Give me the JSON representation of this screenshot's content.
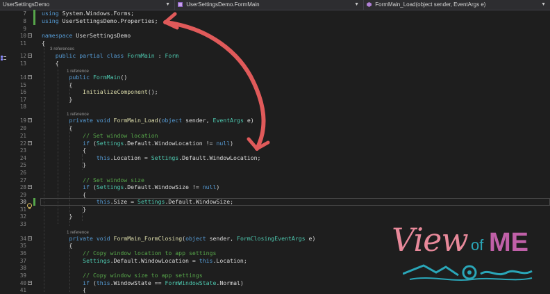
{
  "navigation_bar": {
    "project_dropdown": "UserSettingsDemo",
    "class_dropdown": "UserSettingsDemo.FormMain",
    "member_dropdown": "FormMain_Load(object sender, EventArgs e)"
  },
  "codelens": {
    "refs_3": "3 references",
    "refs_1": "1 reference"
  },
  "lines": [
    {
      "num": "7",
      "code": [
        [
          "k",
          "using"
        ],
        [
          "p",
          " System.Windows.Forms;"
        ]
      ]
    },
    {
      "num": "8",
      "code": [
        [
          "k",
          "using"
        ],
        [
          "p",
          " UserSettingsDemo.Properties;"
        ]
      ]
    },
    {
      "num": "9",
      "code": []
    },
    {
      "num": "10",
      "code": [
        [
          "k",
          "namespace"
        ],
        [
          "p",
          " UserSettingsDemo"
        ]
      ]
    },
    {
      "num": "11",
      "code": [
        [
          "p",
          "{"
        ]
      ]
    },
    {
      "num": "12",
      "code": [
        [
          "p",
          "    "
        ],
        [
          "k",
          "public partial class"
        ],
        [
          "p",
          " "
        ],
        [
          "t",
          "FormMain"
        ],
        [
          "p",
          " : "
        ],
        [
          "t",
          "Form"
        ]
      ]
    },
    {
      "num": "13",
      "code": [
        [
          "p",
          "    {"
        ]
      ]
    },
    {
      "num": "14",
      "code": [
        [
          "p",
          "        "
        ],
        [
          "k",
          "public"
        ],
        [
          "p",
          " "
        ],
        [
          "t",
          "FormMain"
        ],
        [
          "p",
          "()"
        ]
      ]
    },
    {
      "num": "15",
      "code": [
        [
          "p",
          "        {"
        ]
      ]
    },
    {
      "num": "16",
      "code": [
        [
          "p",
          "            "
        ],
        [
          "m",
          "InitializeComponent"
        ],
        [
          "p",
          "();"
        ]
      ]
    },
    {
      "num": "17",
      "code": [
        [
          "p",
          "        }"
        ]
      ]
    },
    {
      "num": "18",
      "code": []
    },
    {
      "num": "19",
      "code": [
        [
          "p",
          "        "
        ],
        [
          "k",
          "private void"
        ],
        [
          "p",
          " "
        ],
        [
          "m",
          "FormMain_Load"
        ],
        [
          "p",
          "("
        ],
        [
          "k",
          "object"
        ],
        [
          "p",
          " sender, "
        ],
        [
          "t",
          "EventArgs"
        ],
        [
          "p",
          " e)"
        ]
      ]
    },
    {
      "num": "20",
      "code": [
        [
          "p",
          "        {"
        ]
      ]
    },
    {
      "num": "21",
      "code": [
        [
          "p",
          "            "
        ],
        [
          "c",
          "// Set window location"
        ]
      ]
    },
    {
      "num": "22",
      "code": [
        [
          "p",
          "            "
        ],
        [
          "k",
          "if"
        ],
        [
          "p",
          " ("
        ],
        [
          "t",
          "Settings"
        ],
        [
          "p",
          ".Default.WindowLocation != "
        ],
        [
          "k",
          "null"
        ],
        [
          "p",
          ")"
        ]
      ]
    },
    {
      "num": "23",
      "code": [
        [
          "p",
          "            {"
        ]
      ]
    },
    {
      "num": "24",
      "code": [
        [
          "p",
          "                "
        ],
        [
          "k",
          "this"
        ],
        [
          "p",
          ".Location = "
        ],
        [
          "t",
          "Settings"
        ],
        [
          "p",
          ".Default.WindowLocation;"
        ]
      ]
    },
    {
      "num": "25",
      "code": [
        [
          "p",
          "            }"
        ]
      ]
    },
    {
      "num": "26",
      "code": []
    },
    {
      "num": "27",
      "code": [
        [
          "p",
          "            "
        ],
        [
          "c",
          "// Set window size"
        ]
      ]
    },
    {
      "num": "28",
      "code": [
        [
          "p",
          "            "
        ],
        [
          "k",
          "if"
        ],
        [
          "p",
          " ("
        ],
        [
          "t",
          "Settings"
        ],
        [
          "p",
          ".Default.WindowSize != "
        ],
        [
          "k",
          "null"
        ],
        [
          "p",
          ")"
        ]
      ]
    },
    {
      "num": "29",
      "code": [
        [
          "p",
          "            {"
        ]
      ]
    },
    {
      "num": "30",
      "code": [
        [
          "p",
          "                "
        ],
        [
          "k",
          "this"
        ],
        [
          "p",
          ".Size = "
        ],
        [
          "t",
          "Settings"
        ],
        [
          "p",
          ".Default.WindowSize;"
        ]
      ]
    },
    {
      "num": "31",
      "code": [
        [
          "p",
          "            }"
        ]
      ]
    },
    {
      "num": "32",
      "code": [
        [
          "p",
          "        }"
        ]
      ]
    },
    {
      "num": "33",
      "code": []
    },
    {
      "num": "34",
      "code": [
        [
          "p",
          "        "
        ],
        [
          "k",
          "private void"
        ],
        [
          "p",
          " "
        ],
        [
          "m",
          "FormMain_FormClosing"
        ],
        [
          "p",
          "("
        ],
        [
          "k",
          "object"
        ],
        [
          "p",
          " sender, "
        ],
        [
          "t",
          "FormClosingEventArgs"
        ],
        [
          "p",
          " e)"
        ]
      ]
    },
    {
      "num": "35",
      "code": [
        [
          "p",
          "        {"
        ]
      ]
    },
    {
      "num": "36",
      "code": [
        [
          "p",
          "            "
        ],
        [
          "c",
          "// Copy window location to app settings"
        ]
      ]
    },
    {
      "num": "37",
      "code": [
        [
          "p",
          "            "
        ],
        [
          "t",
          "Settings"
        ],
        [
          "p",
          ".Default.WindowLocation = "
        ],
        [
          "k",
          "this"
        ],
        [
          "p",
          ".Location;"
        ]
      ]
    },
    {
      "num": "38",
      "code": []
    },
    {
      "num": "39",
      "code": [
        [
          "p",
          "            "
        ],
        [
          "c",
          "// Copy window size to app settings"
        ]
      ]
    },
    {
      "num": "40",
      "code": [
        [
          "p",
          "            "
        ],
        [
          "k",
          "if"
        ],
        [
          "p",
          " ("
        ],
        [
          "k",
          "this"
        ],
        [
          "p",
          ".WindowState == "
        ],
        [
          "t",
          "FormWindowState"
        ],
        [
          "p",
          ".Normal)"
        ]
      ]
    },
    {
      "num": "41",
      "code": [
        [
          "p",
          "            {"
        ]
      ]
    }
  ],
  "logo": {
    "word_view": "View",
    "word_of": "of",
    "word_me": "ME"
  },
  "colors": {
    "keyword": "#569cd6",
    "type": "#4ec9b0",
    "method": "#dcdcaa",
    "comment": "#57a64a",
    "annotation_arrow": "#e05a5a"
  }
}
